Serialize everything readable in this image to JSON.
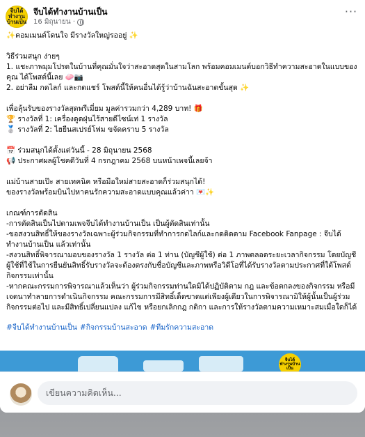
{
  "page": {
    "name": "จีบได้ทำงานบ้านเป็น",
    "avatar_text": "จีบได้ ทำงานบ้านเป็น",
    "post_time": "16 มิถุนายน ·"
  },
  "post": {
    "lines": [
      "✨คอมเมนต์โดนใจ มีรางวัลใหญ่รออยู่ ✨",
      "",
      "วิธีร่วมสนุก ง่ายๆ",
      "1. แชะภาพมุมโปรดในบ้านที่คุณมั่นใจว่าสะอาดสุดในสามโลก พร้อมคอมเมนต์บอกวิธีทำความสะอาดในแบบของคุณ ได้โพสต์นี้เลย 🧼📷",
      "2. อย่าลืม กดไลก์ และกดแชร์ โพสต์นี้ให้คนอื่นได้รู้ว่าบ้านฉันสะอาดขั้นสุด ✨",
      "",
      "เพื่อลุ้นรับของรางวัลสุดพรีเมี่ยม มูลค่ารวมกว่า 4,289 บาท! 🎁",
      "🏆 รางวัลที่ 1: เครื่องดูดฝุ่นไร้สายดีไซน์เท่ 1 รางวัล",
      "🥈 รางวัลที่ 2: ไฮยีนสเปรย์โฟม ขจัดคราบ 5 รางวัล",
      "",
      "📅 ร่วมสนุกได้ตั้งแต่วันนี้ - 28 มิถุนายน 2568",
      "📢 ประกาศผลผู้โชคดีวันที่ 4 กรกฎาคม 2568 บนหน้าเพจนี้เลยจ้า",
      "",
      "แม่บ้านสายเป๊ะ สายเทคนิค หรือมือใหม่สายสะอาดก็ร่วมสนุกได้!",
      "ของรางวัลพร้อมบินไปหาคนรักความสะอาดแบบคุณแล้วค่าา 💌✨",
      "",
      "เกณฑ์การตัดสิน",
      "-การตัดสินเป็นไปตามเพจจีบได้ทำงานบ้านเป็น เป็นผู้ตัดสินเท่านั้น",
      "-ขอสงวนสิทธิ์ให้ของรางวัลเฉพาะผู้ร่วมกิจกรรมที่ทำการกดไลก์และกดติดตาม Facebook Fanpage : จีบได้ทำงานบ้านเป็น แล้วเท่านั้น",
      "-สงวนสิทธิ์พิจารณามอบของรางวัล 1 รางวัล ต่อ 1 ท่าน (บัญชีผู้ใช้) ต่อ 1 ภาพตลอดระยะเวลากิจกรรม โดยบัญชีผู้ใช้ที่ใช้ในการยืนยันสิทธิ์รับรางวัลจะต้องตรงกับชื่อบัญชีและภาพหรือวิดีโอที่ได้รับรางวัลตามประกาศที่ใต้โพสต์กิจกรรมเท่านั้น",
      "-หากคณะกรรมการพิจารณาแล้วเห็นว่า ผู้ร่วมกิจกรรมท่านใดมิได้ปฏิบัติตาม กฎ และข้อตกลงของกิจกรรม หรือมีเจตนาทำลายการดำเนินกิจกรรม คณะกรรมการมีสิทธิ์เด็ดขาดแต่เพียงผู้เดียวในการพิจารณามิให้ผู้นั้นเป็นผู้ร่วมกิจกรรมต่อไป และมีสิทธิ์เปลี่ยนแปลง แก้ไข หรือยกเลิกกฎ กติกา และการให้รางวัลตามความเหมาะสมเมื่อใดก็ได้"
    ],
    "hashtags": [
      "#จีบได้ทำงานบ้านเป็น",
      "#กิจกรรมบ้านสะอาด",
      "#ทีมรักความสะอาด"
    ]
  },
  "preview": {
    "badge_text": "จีบได้ ทำงานบ้านเป็น"
  },
  "comment": {
    "placeholder": "เขียนความคิดเห็น..."
  },
  "colors": {
    "link": "#1461c7",
    "brand_yellow": "#f5d000",
    "preview_blue": "#3d9ad6"
  }
}
